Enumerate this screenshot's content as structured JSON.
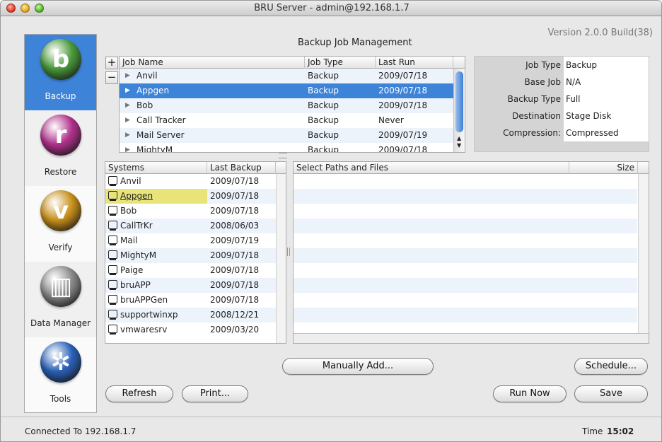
{
  "window": {
    "title": "BRU Server - admin@192.168.1.7"
  },
  "version": "Version 2.0.0 Build(38)",
  "mgmt_title": "Backup Job Management",
  "sidebar": [
    {
      "label": "Backup",
      "icon": "backup-icon",
      "glyph": "b",
      "color": "#4a9a3a",
      "active": true
    },
    {
      "label": "Restore",
      "icon": "restore-icon",
      "glyph": "r",
      "color": "#b0308c"
    },
    {
      "label": "Verify",
      "icon": "verify-icon",
      "glyph": "v",
      "color": "#c8901a"
    },
    {
      "label": "Data Manager",
      "icon": "data-manager-icon",
      "glyph": "▥",
      "color": "#8a8a8a"
    },
    {
      "label": "Tools",
      "icon": "tools-icon",
      "glyph": "✲",
      "color": "#2a60b8"
    }
  ],
  "jobs": {
    "columns": [
      "Job Name",
      "Job Type",
      "Last Run"
    ],
    "rows": [
      {
        "name": "Anvil",
        "type": "Backup",
        "last": "2009/07/18"
      },
      {
        "name": "Appgen",
        "type": "Backup",
        "last": "2009/07/18",
        "selected": true
      },
      {
        "name": "Bob",
        "type": "Backup",
        "last": "2009/07/18"
      },
      {
        "name": "Call Tracker",
        "type": "Backup",
        "last": "Never"
      },
      {
        "name": "Mail Server",
        "type": "Backup",
        "last": "2009/07/19"
      },
      {
        "name": "MightyM",
        "type": "Backup",
        "last": "2009/07/18"
      }
    ]
  },
  "props": [
    {
      "label": "Job Type",
      "value": "Backup"
    },
    {
      "label": "Base Job",
      "value": "N/A"
    },
    {
      "label": "Backup Type",
      "value": "Full"
    },
    {
      "label": "Destination",
      "value": "Stage Disk"
    },
    {
      "label": "Compression:",
      "value": "Compressed"
    }
  ],
  "systems": {
    "columns": [
      "Systems",
      "Last Backup"
    ],
    "rows": [
      {
        "name": "Anvil",
        "last": "2009/07/18"
      },
      {
        "name": "Appgen",
        "last": "2009/07/18",
        "selected": true
      },
      {
        "name": "Bob",
        "last": "2009/07/18"
      },
      {
        "name": "CallTrKr",
        "last": "2008/06/03"
      },
      {
        "name": "Mail",
        "last": "2009/07/19"
      },
      {
        "name": "MightyM",
        "last": "2009/07/18"
      },
      {
        "name": "Paige",
        "last": "2009/07/18"
      },
      {
        "name": "bruAPP",
        "last": "2009/07/18"
      },
      {
        "name": "bruAPPGen",
        "last": "2009/07/18"
      },
      {
        "name": "supportwinxp",
        "last": "2008/12/21"
      },
      {
        "name": "vmwaresrv",
        "last": "2009/03/20"
      }
    ]
  },
  "paths": {
    "columns": [
      "Select Paths and Files",
      "Size"
    ]
  },
  "buttons": {
    "add": "+",
    "remove": "−",
    "manually_add": "Manually Add...",
    "schedule": "Schedule...",
    "refresh": "Refresh",
    "print": "Print...",
    "run_now": "Run Now",
    "save": "Save"
  },
  "status": {
    "connected": "Connected To 192.168.1.7",
    "time_label": "Time",
    "time": "15:02"
  },
  "colors": {
    "selection": "#3d83d8",
    "highlight": "#e8e47a"
  }
}
